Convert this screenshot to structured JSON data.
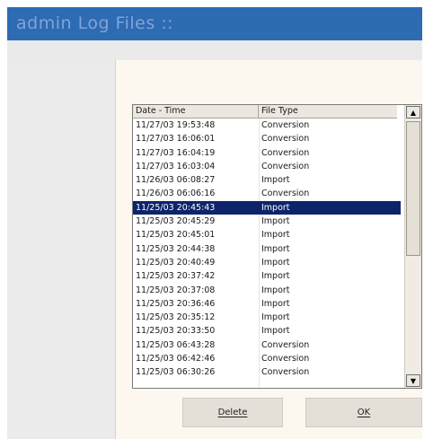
{
  "window": {
    "title": "admin Log Files ::"
  },
  "log_table": {
    "columns": [
      "Date - Time",
      "File Type"
    ],
    "rows": [
      [
        "11/27/03 19:53:48",
        "Conversion"
      ],
      [
        "11/27/03 16:06:01",
        "Conversion"
      ],
      [
        "11/27/03 16:04:19",
        "Conversion"
      ],
      [
        "11/27/03 16:03:04",
        "Conversion"
      ],
      [
        "11/26/03 06:08:27",
        "Import"
      ],
      [
        "11/26/03 06:06:16",
        "Conversion"
      ],
      [
        "11/25/03 20:45:43",
        "Import"
      ],
      [
        "11/25/03 20:45:29",
        "Import"
      ],
      [
        "11/25/03 20:45:01",
        "Import"
      ],
      [
        "11/25/03 20:44:38",
        "Import"
      ],
      [
        "11/25/03 20:40:49",
        "Import"
      ],
      [
        "11/25/03 20:37:42",
        "Import"
      ],
      [
        "11/25/03 20:37:08",
        "Import"
      ],
      [
        "11/25/03 20:36:46",
        "Import"
      ],
      [
        "11/25/03 20:35:12",
        "Import"
      ],
      [
        "11/25/03 20:33:50",
        "Import"
      ],
      [
        "11/25/03 06:43:28",
        "Conversion"
      ],
      [
        "11/25/03 06:42:46",
        "Conversion"
      ],
      [
        "11/25/03 06:30:26",
        "Conversion"
      ]
    ],
    "selected_index": 6
  },
  "scrollbar": {
    "up_icon": "arrow-up-icon",
    "down_icon": "arrow-down-icon"
  },
  "buttons": {
    "delete_label": "Delete",
    "ok_label": "OK"
  },
  "colors": {
    "titlebar": "#2d6bb3",
    "selection": "#0d246a",
    "panel": "#fcf8f0"
  }
}
